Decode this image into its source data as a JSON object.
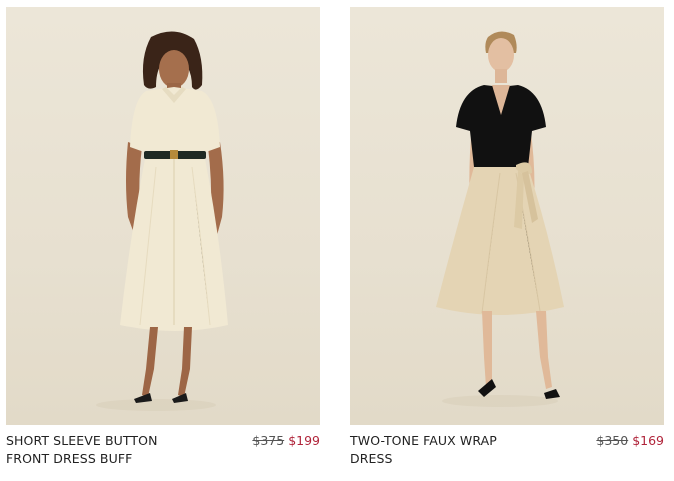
{
  "products": [
    {
      "name_line1": "SHORT SLEEVE BUTTON",
      "name_line2": "FRONT DRESS BUFF",
      "original_price": "$375",
      "sale_price": "$199",
      "dress_color": "#f1e9d3",
      "belt_color": "#1f2a24"
    },
    {
      "name_line1": "TWO-TONE FAUX WRAP",
      "name_line2": "DRESS",
      "original_price": "$350",
      "sale_price": "$169",
      "bodice_color": "#111111",
      "skirt_color": "#e4d4b4"
    }
  ],
  "colors": {
    "background": "#e9e2d2",
    "sale": "#b0243a",
    "text": "#222222"
  }
}
